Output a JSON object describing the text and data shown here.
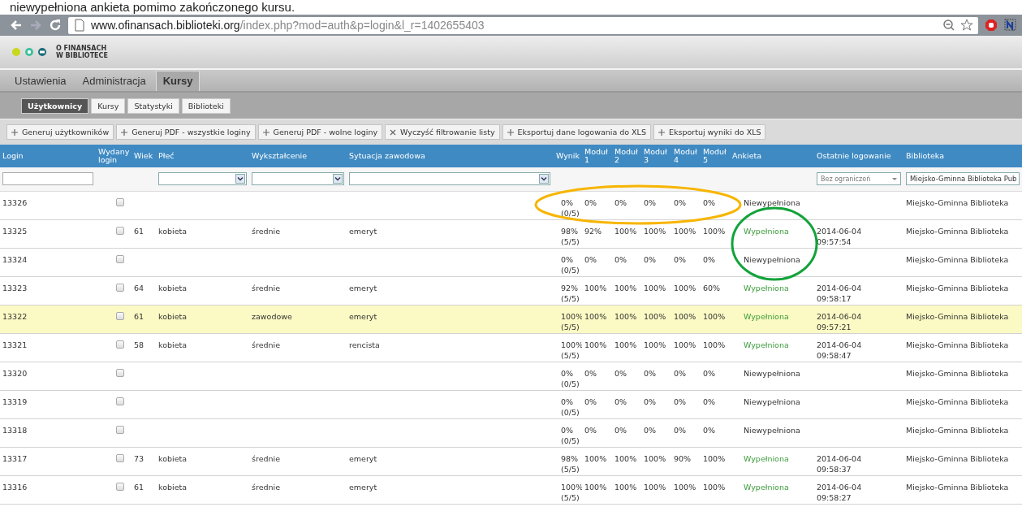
{
  "caption": "niewypełniona ankieta pomimo zakończonego kursu.",
  "browser": {
    "url_host": "www.ofinansach.biblioteki.org",
    "url_path": "/index.php?mod=auth&p=login&l_r=1402655403"
  },
  "logo": {
    "line1": "O FINANSACH",
    "line2": "W BIBLIOTECE"
  },
  "main_tabs": [
    {
      "label": "Ustawienia",
      "selected": false
    },
    {
      "label": "Administracja",
      "selected": false
    },
    {
      "label": "Kursy",
      "selected": true
    }
  ],
  "sub_tabs": [
    {
      "label": "Użytkownicy",
      "selected": true
    },
    {
      "label": "Kursy",
      "selected": false
    },
    {
      "label": "Statystyki",
      "selected": false
    },
    {
      "label": "Biblioteki",
      "selected": false
    }
  ],
  "toolbar_buttons": [
    {
      "kind": "add",
      "label": "Generuj użytkowników"
    },
    {
      "kind": "add",
      "label": "Generuj PDF - wszystkie loginy"
    },
    {
      "kind": "add",
      "label": "Generuj PDF - wolne loginy"
    },
    {
      "kind": "clear",
      "label": "Wyczyść filtrowanie listy"
    },
    {
      "kind": "add",
      "label": "Eksportuj dane logowania do XLS"
    },
    {
      "kind": "add",
      "label": "Eksportuj wyniki do XLS"
    }
  ],
  "columns": [
    "Login",
    "Wydany login",
    "Wiek",
    "Płeć",
    "Wykształcenie",
    "Sytuacja zawodowa",
    "Wynik",
    "Moduł 1",
    "Moduł 2",
    "Moduł 3",
    "Moduł 4",
    "Moduł 5",
    "Ankieta",
    "Ostatnie logowanie",
    "Biblioteka"
  ],
  "filters": {
    "last_login": "Bez ograniczeń",
    "library": "Miejsko-Gminna Biblioteka Pub"
  },
  "rows": [
    {
      "login": "13326",
      "issued": false,
      "age": "",
      "gender": "",
      "education": "",
      "situation": "",
      "result": "0%",
      "result_count": "(0/5)",
      "modules": [
        "0%",
        "0%",
        "0%",
        "0%",
        "0%"
      ],
      "survey": "Niewypełniona",
      "survey_filled": false,
      "date": "",
      "time": "",
      "library": "Miejsko-Gminna Biblioteka",
      "selected": false
    },
    {
      "login": "13325",
      "issued": false,
      "age": "61",
      "gender": "kobieta",
      "education": "średnie",
      "situation": "emeryt",
      "result": "98%",
      "result_count": "(5/5)",
      "modules": [
        "92%",
        "100%",
        "100%",
        "100%",
        "100%"
      ],
      "survey": "Wypełniona",
      "survey_filled": true,
      "date": "2014-06-04",
      "time": "09:57:54",
      "library": "Miejsko-Gminna Biblioteka",
      "selected": false
    },
    {
      "login": "13324",
      "issued": false,
      "age": "",
      "gender": "",
      "education": "",
      "situation": "",
      "result": "0%",
      "result_count": "(0/5)",
      "modules": [
        "0%",
        "0%",
        "0%",
        "0%",
        "0%"
      ],
      "survey": "Niewypełniona",
      "survey_filled": false,
      "date": "",
      "time": "",
      "library": "Miejsko-Gminna Biblioteka",
      "selected": false
    },
    {
      "login": "13323",
      "issued": false,
      "age": "64",
      "gender": "kobieta",
      "education": "średnie",
      "situation": "emeryt",
      "result": "92%",
      "result_count": "(5/5)",
      "modules": [
        "100%",
        "100%",
        "100%",
        "100%",
        "60%"
      ],
      "survey": "Wypełniona",
      "survey_filled": true,
      "date": "2014-06-04",
      "time": "09:58:17",
      "library": "Miejsko-Gminna Biblioteka",
      "selected": false
    },
    {
      "login": "13322",
      "issued": false,
      "age": "61",
      "gender": "kobieta",
      "education": "zawodowe",
      "situation": "emeryt",
      "result": "100%",
      "result_count": "(5/5)",
      "modules": [
        "100%",
        "100%",
        "100%",
        "100%",
        "100%"
      ],
      "survey": "Wypełniona",
      "survey_filled": true,
      "date": "2014-06-04",
      "time": "09:57:21",
      "library": "Miejsko-Gminna Biblioteka",
      "selected": true
    },
    {
      "login": "13321",
      "issued": false,
      "age": "58",
      "gender": "kobieta",
      "education": "średnie",
      "situation": "rencista",
      "result": "100%",
      "result_count": "(5/5)",
      "modules": [
        "100%",
        "100%",
        "100%",
        "100%",
        "100%"
      ],
      "survey": "Wypełniona",
      "survey_filled": true,
      "date": "2014-06-04",
      "time": "09:58:47",
      "library": "Miejsko-Gminna Biblioteka",
      "selected": false
    },
    {
      "login": "13320",
      "issued": false,
      "age": "",
      "gender": "",
      "education": "",
      "situation": "",
      "result": "0%",
      "result_count": "(0/5)",
      "modules": [
        "0%",
        "0%",
        "0%",
        "0%",
        "0%"
      ],
      "survey": "Niewypełniona",
      "survey_filled": false,
      "date": "",
      "time": "",
      "library": "Miejsko-Gminna Biblioteka",
      "selected": false
    },
    {
      "login": "13319",
      "issued": false,
      "age": "",
      "gender": "",
      "education": "",
      "situation": "",
      "result": "0%",
      "result_count": "(0/5)",
      "modules": [
        "0%",
        "0%",
        "0%",
        "0%",
        "0%"
      ],
      "survey": "Niewypełniona",
      "survey_filled": false,
      "date": "",
      "time": "",
      "library": "Miejsko-Gminna Biblioteka",
      "selected": false
    },
    {
      "login": "13318",
      "issued": false,
      "age": "",
      "gender": "",
      "education": "",
      "situation": "",
      "result": "0%",
      "result_count": "(0/5)",
      "modules": [
        "0%",
        "0%",
        "0%",
        "0%",
        "0%"
      ],
      "survey": "Niewypełniona",
      "survey_filled": false,
      "date": "",
      "time": "",
      "library": "Miejsko-Gminna Biblioteka",
      "selected": false
    },
    {
      "login": "13317",
      "issued": false,
      "age": "73",
      "gender": "kobieta",
      "education": "średnie",
      "situation": "emeryt",
      "result": "98%",
      "result_count": "(5/5)",
      "modules": [
        "100%",
        "100%",
        "100%",
        "90%",
        "100%"
      ],
      "survey": "Wypełniona",
      "survey_filled": true,
      "date": "2014-06-04",
      "time": "09:58:37",
      "library": "Miejsko-Gminna Biblioteka",
      "selected": false
    },
    {
      "login": "13316",
      "issued": false,
      "age": "61",
      "gender": "kobieta",
      "education": "średnie",
      "situation": "emeryt",
      "result": "100%",
      "result_count": "(5/5)",
      "modules": [
        "100%",
        "100%",
        "100%",
        "100%",
        "100%"
      ],
      "survey": "Wypełniona",
      "survey_filled": true,
      "date": "2014-06-04",
      "time": "09:58:27",
      "library": "Miejsko-Gminna Biblioteka",
      "selected": false
    }
  ],
  "annotations": [
    {
      "kind": "wide",
      "color": "#f7b500"
    },
    {
      "kind": "round",
      "color": "#12a33a"
    }
  ]
}
